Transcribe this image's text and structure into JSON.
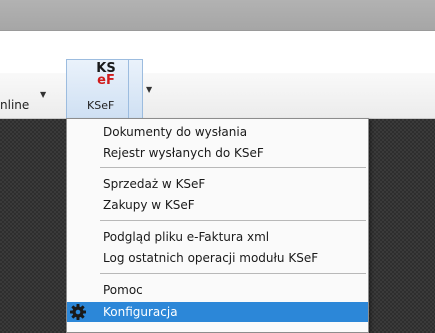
{
  "ribbon": {
    "prev_button_label": "nline",
    "ksef_button": {
      "logo_line1": "KS",
      "logo_line2": "eF",
      "label": "KSeF"
    }
  },
  "menu": {
    "items": [
      {
        "label": "Dokumenty do wysłania"
      },
      {
        "label": "Rejestr wysłanych do KSeF"
      },
      {
        "label": "Sprzedaż w KSeF"
      },
      {
        "label": "Zakupy w KSeF"
      },
      {
        "label": "Podgląd pliku e-Faktura xml"
      },
      {
        "label": "Log ostatnich operacji modułu KSeF"
      },
      {
        "label": "Pomoc"
      },
      {
        "label": "Konfiguracja",
        "icon": "gear-icon",
        "selected": true
      }
    ]
  },
  "colors": {
    "selection": "#2c87d8",
    "logo_red": "#d01c1c"
  }
}
